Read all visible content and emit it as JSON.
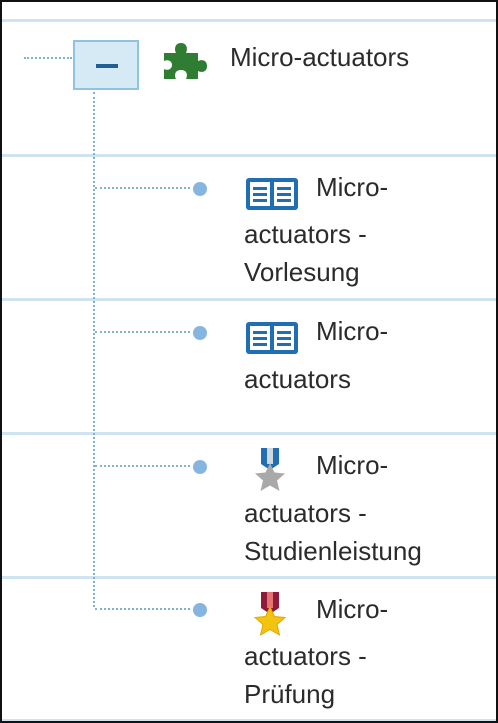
{
  "tree": {
    "root": {
      "toggle_icon": "collapse-minus-icon",
      "icon": "puzzle-icon",
      "icon_color": "#2e7d32",
      "label": "Micro-actuators"
    },
    "children": [
      {
        "icon": "book-icon",
        "label_lines": [
          "Micro-",
          "actuators -",
          "Vorlesung"
        ]
      },
      {
        "icon": "book-icon",
        "label_lines": [
          "Micro-",
          "actuators"
        ]
      },
      {
        "icon": "silver-medal-icon",
        "label_lines": [
          "Micro-",
          "actuators -",
          "Studienleistung"
        ]
      },
      {
        "icon": "gold-medal-icon",
        "label_lines": [
          "Micro-",
          "actuators -",
          "Prüfung"
        ]
      }
    ]
  },
  "colors": {
    "row_divider": "#cfe3f1",
    "connector": "#7fb3d5",
    "toggle_bg": "#d6eaf6",
    "toggle_border": "#8fc3e0",
    "bullet": "#86b6df",
    "text": "#2b2b2b",
    "book_icon": "#1f6fb2"
  }
}
